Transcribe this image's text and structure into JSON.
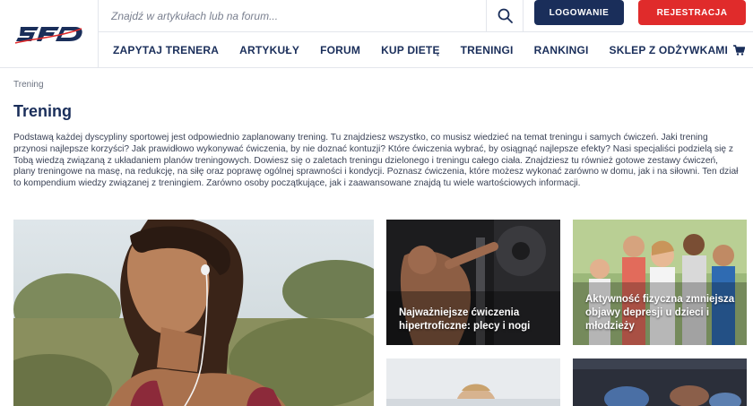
{
  "header": {
    "logo_text": "SFD",
    "search": {
      "placeholder": "Znajdź w artykułach lub na forum..."
    },
    "login_label": "LOGOWANIE",
    "register_label": "REJESTRACJA"
  },
  "nav": {
    "items": [
      {
        "label": "ZAPYTAJ TRENERA"
      },
      {
        "label": "ARTYKUŁY"
      },
      {
        "label": "FORUM"
      },
      {
        "label": "KUP DIETĘ"
      },
      {
        "label": "TRENINGI"
      },
      {
        "label": "RANKINGI"
      },
      {
        "label": "SKLEP Z ODŻYWKAMI",
        "icon": "cart-icon"
      }
    ]
  },
  "breadcrumb": "Trening",
  "page": {
    "title": "Trening",
    "intro": "Podstawą każdej dyscypliny sportowej jest odpowiednio zaplanowany trening. Tu znajdziesz wszystko, co musisz wiedzieć na temat treningu i samych ćwiczeń. Jaki trening przynosi najlepsze korzyści? Jak prawidłowo wykonywać ćwiczenia, by nie doznać kontuzji? Które ćwiczenia wybrać, by osiągnąć najlepsze efekty? Nasi specjaliści podzielą się z Tobą wiedzą związaną z układaniem planów treningowych. Dowiesz się o zaletach treningu dzielonego i treningu całego ciała. Znajdziesz tu również gotowe zestawy ćwiczeń, plany treningowe na masę, na redukcję, na siłę oraz poprawę ogólnej sprawności i kondycji. Poznasz ćwiczenia, które możesz wykonać zarówno w domu, jak i na siłowni. Ten dział to kompendium wiedzy związanej z treningiem. Zarówno osoby początkujące, jak i zaawansowane znajdą tu wiele wartościowych informacji."
  },
  "articles": [
    {
      "title": "Najważniejsze ćwiczenia hipertroficzne: plecy i nogi"
    },
    {
      "title": "Aktywność fizyczna zmniejsza objawy depresji u dzieci i młodzieży"
    }
  ],
  "colors": {
    "brand_navy": "#1a2e5a",
    "register_red": "#e02b2b"
  }
}
